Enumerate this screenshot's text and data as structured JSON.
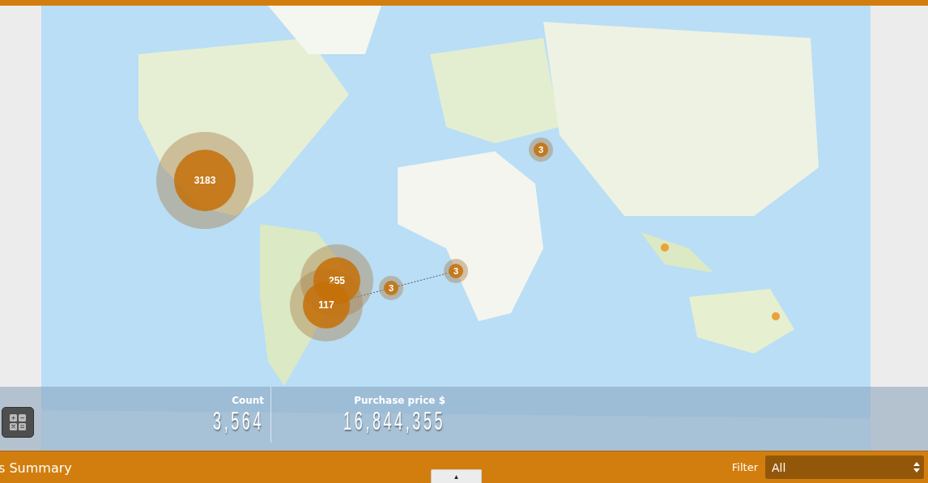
{
  "map": {
    "clusters": [
      {
        "kind": "cluster",
        "count": "3183"
      },
      {
        "kind": "cluster",
        "count": "255"
      },
      {
        "kind": "cluster",
        "count": "117"
      },
      {
        "kind": "cluster",
        "count": "3"
      },
      {
        "kind": "cluster",
        "count": "3"
      },
      {
        "kind": "cluster",
        "count": "3"
      },
      {
        "kind": "point"
      },
      {
        "kind": "point"
      }
    ]
  },
  "summary": {
    "stats": [
      {
        "label": "Count",
        "value": "3,564"
      },
      {
        "label": "Purchase price $",
        "value": "16,844,355"
      }
    ]
  },
  "footer": {
    "title": "s Summary",
    "toggle": "▲",
    "filter": {
      "label": "Filter",
      "value": "All"
    }
  }
}
